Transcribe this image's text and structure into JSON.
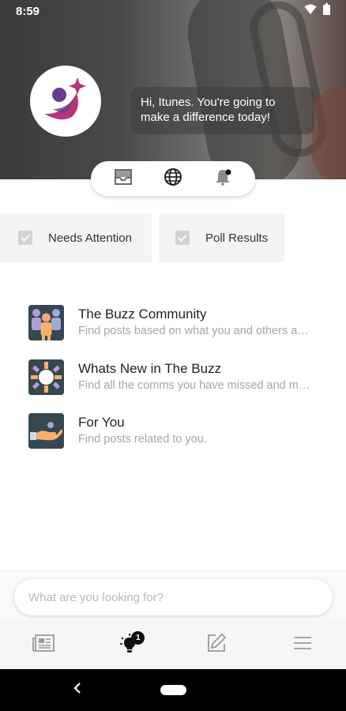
{
  "status_bar": {
    "time": "8:59",
    "icons": [
      "wifi-icon",
      "battery-icon"
    ]
  },
  "header": {
    "greeting": "Hi, Itunes. You're going to make a difference today!",
    "avatar_icon": "buzz-logo-icon",
    "segment_icons": [
      "inbox-icon",
      "globe-icon",
      "bell-icon"
    ]
  },
  "filters": [
    {
      "label": "Needs Attention",
      "checked": true
    },
    {
      "label": "Poll Results",
      "checked": true
    }
  ],
  "list": [
    {
      "title": "The Buzz Community",
      "subtitle": "Find posts based on what you and others are interested in",
      "icon": "community-icon"
    },
    {
      "title": "Whats New in The Buzz",
      "subtitle": "Find all the comms you have missed and more",
      "icon": "sun-icon"
    },
    {
      "title": "For You",
      "subtitle": "Find posts related to you.",
      "icon": "hand-icon"
    }
  ],
  "search": {
    "placeholder": "What are you looking for?",
    "value": ""
  },
  "tab_bar": {
    "tabs": [
      {
        "name": "newspaper-icon"
      },
      {
        "name": "lightbulb-icon",
        "badge": "1"
      },
      {
        "name": "edit-icon"
      },
      {
        "name": "menu-icon"
      }
    ]
  },
  "colors": {
    "accent_purple": "#6a3b8f",
    "accent_magenta": "#b8357a",
    "thumb_bg": "#37474f"
  }
}
